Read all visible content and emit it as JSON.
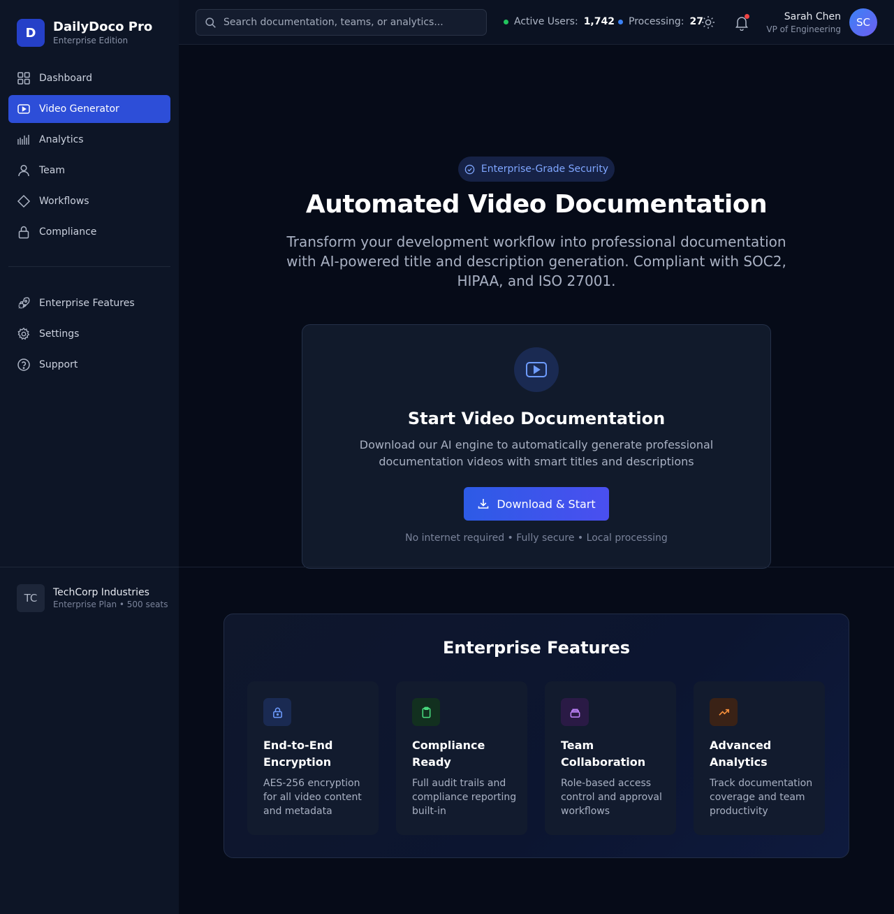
{
  "brand": {
    "logo_letter": "D",
    "name": "DailyDoco Pro",
    "edition": "Enterprise Edition"
  },
  "nav": {
    "main": [
      {
        "label": "Dashboard",
        "icon": "grid-icon"
      },
      {
        "label": "Video Generator",
        "icon": "video-icon",
        "active": true
      },
      {
        "label": "Analytics",
        "icon": "bar-chart-icon"
      },
      {
        "label": "Team",
        "icon": "user-icon"
      },
      {
        "label": "Workflows",
        "icon": "diamond-icon"
      },
      {
        "label": "Compliance",
        "icon": "lock-icon"
      }
    ],
    "secondary": [
      {
        "label": "Enterprise Features",
        "icon": "rocket-icon"
      },
      {
        "label": "Settings",
        "icon": "gear-icon"
      },
      {
        "label": "Support",
        "icon": "help-icon"
      }
    ]
  },
  "org": {
    "initials": "TC",
    "name": "TechCorp Industries",
    "plan": "Enterprise Plan • 500 seats"
  },
  "header": {
    "search_placeholder": "Search documentation, teams, or analytics...",
    "active_users_label": "Active Users:",
    "active_users_value": "1,742",
    "processing_label": "Processing:",
    "processing_value": "27",
    "user_name": "Sarah Chen",
    "user_role": "VP of Engineering",
    "user_initials": "SC"
  },
  "hero": {
    "badge": "Enterprise-Grade Security",
    "title": "Automated Video Documentation",
    "subtitle": "Transform your development workflow into professional documentation with AI-powered title and description generation. Compliant with SOC2, HIPAA, and ISO 27001."
  },
  "start_card": {
    "title": "Start Video Documentation",
    "description": "Download our AI engine to automatically generate professional documentation videos with smart titles and descriptions",
    "button_label": "Download & Start",
    "note": "No internet required • Fully secure • Local processing"
  },
  "features": {
    "title": "Enterprise Features",
    "items": [
      {
        "title": "End-to-End Encryption",
        "description": "AES-256 encryption for all video content and metadata",
        "icon": "lock-icon",
        "color": "#6e9cff",
        "bg": "#1a2a52"
      },
      {
        "title": "Compliance Ready",
        "description": "Full audit trails and compliance reporting built-in",
        "icon": "clipboard-icon",
        "color": "#4ade80",
        "bg": "#12301f"
      },
      {
        "title": "Team Collaboration",
        "description": "Role-based access control and approval workflows",
        "icon": "layers-icon",
        "color": "#c084fc",
        "bg": "#2a1a45"
      },
      {
        "title": "Advanced Analytics",
        "description": "Track documentation coverage and team productivity",
        "icon": "trending-up-icon",
        "color": "#fb923c",
        "bg": "#3a2216"
      }
    ]
  },
  "colors": {
    "accent": "#2d4ed8",
    "active_dot": "#22c55e",
    "processing_dot": "#3b82f6",
    "notification": "#ef4444"
  }
}
